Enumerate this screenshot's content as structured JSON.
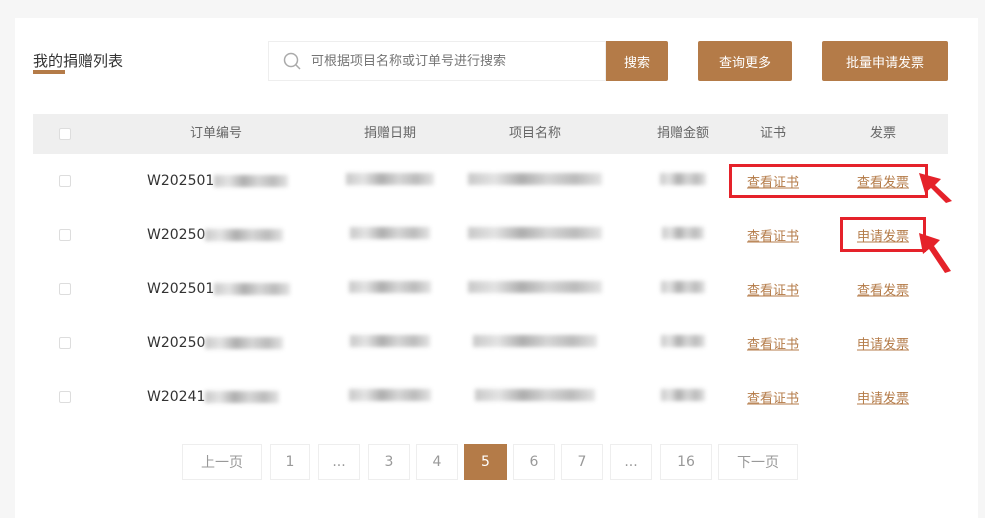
{
  "header": {
    "title": "我的捐赠列表",
    "search_placeholder": "可根据项目名称或订单号进行搜索",
    "search_button": "搜索",
    "more_button": "查询更多",
    "batch_button": "批量申请发票"
  },
  "table": {
    "columns": [
      "订单编号",
      "捐赠日期",
      "项目名称",
      "捐赠金额",
      "证书",
      "发票"
    ],
    "rows": [
      {
        "order_prefix": "W202501",
        "cert": "查看证书",
        "invoice": "查看发票"
      },
      {
        "order_prefix": "W20250",
        "cert": "查看证书",
        "invoice": "申请发票"
      },
      {
        "order_prefix": "W202501",
        "cert": "查看证书",
        "invoice": "查看发票"
      },
      {
        "order_prefix": "W20250",
        "cert": "查看证书",
        "invoice": "申请发票"
      },
      {
        "order_prefix": "W20241",
        "cert": "查看证书",
        "invoice": "申请发票"
      }
    ]
  },
  "pagination": {
    "prev": "上一页",
    "next": "下一页",
    "pages": [
      "1",
      "...",
      "3",
      "4",
      "5",
      "6",
      "7",
      "...",
      "16"
    ],
    "current": "5"
  },
  "colors": {
    "accent": "#b47b48",
    "annotation": "#e5222a"
  }
}
